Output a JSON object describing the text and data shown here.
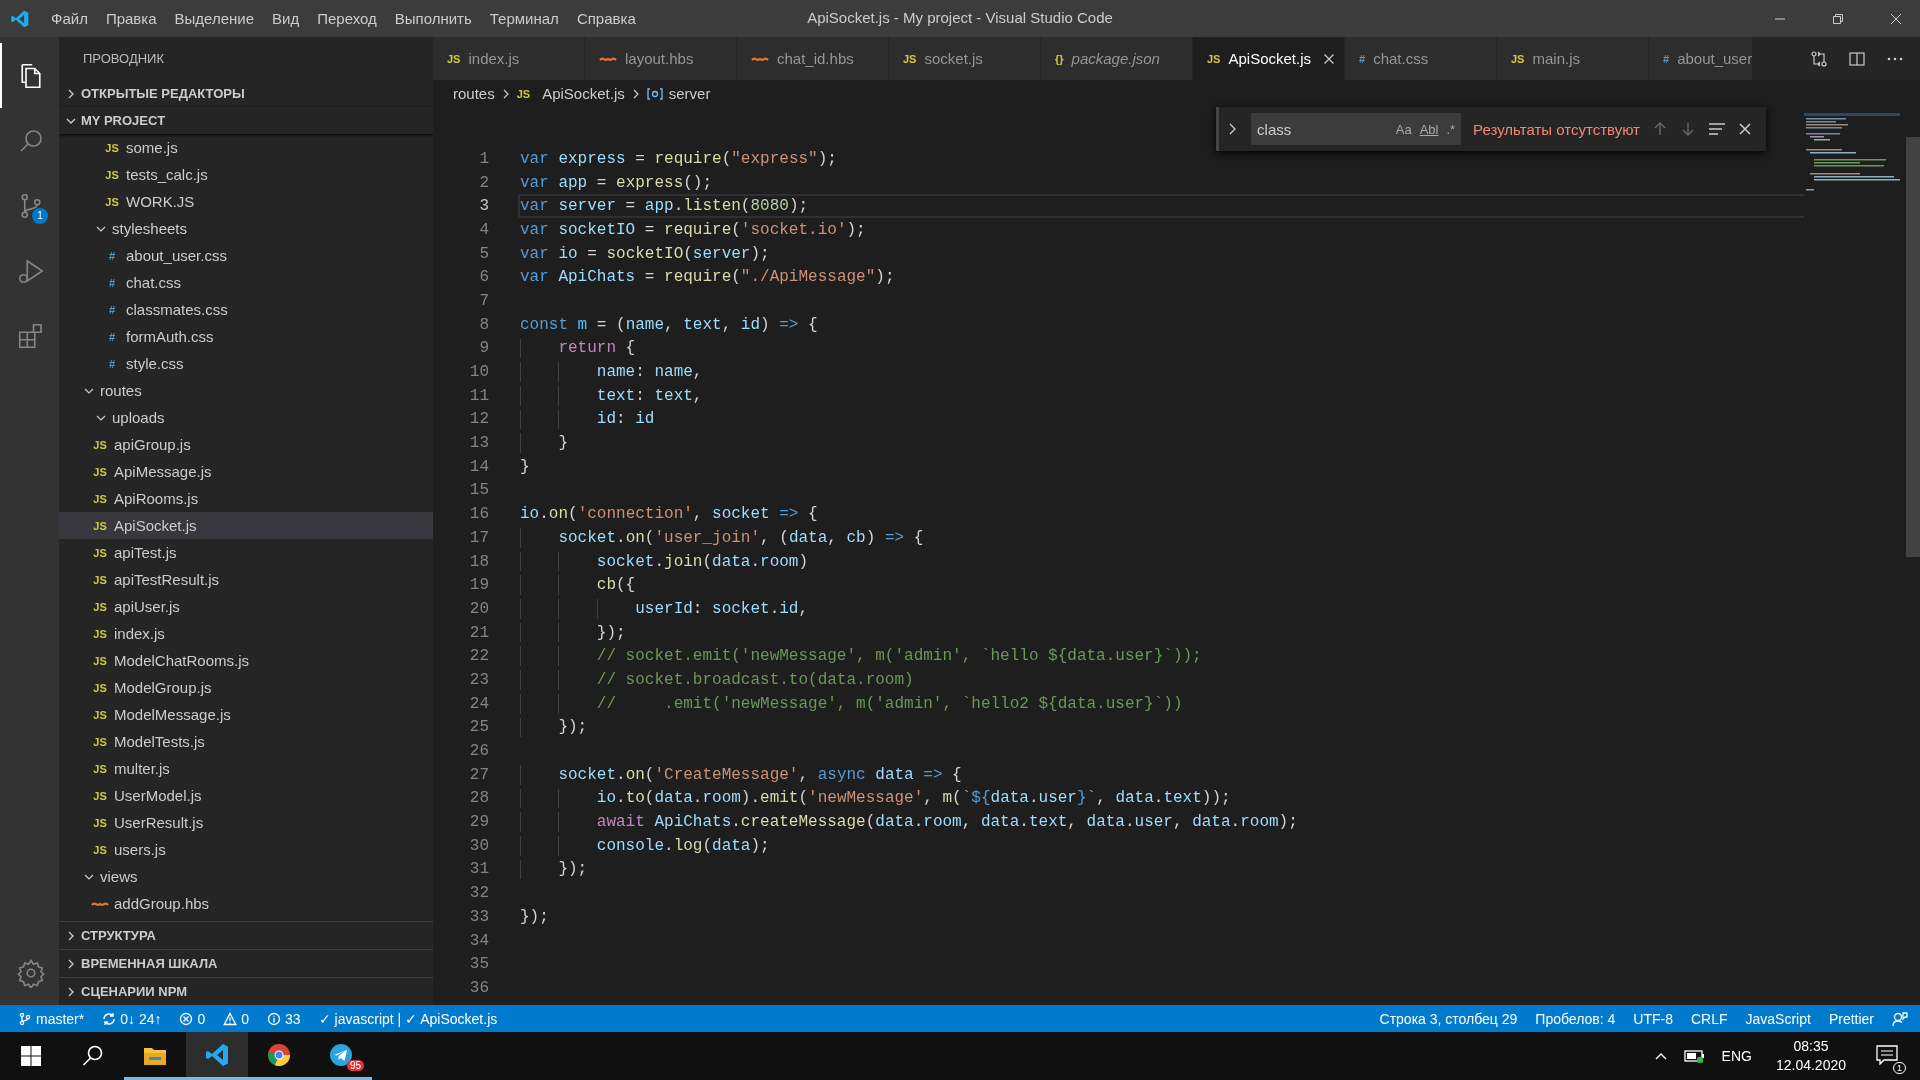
{
  "title_bar": {
    "menu": [
      "Файл",
      "Правка",
      "Выделение",
      "Вид",
      "Переход",
      "Выполнить",
      "Терминал",
      "Справка"
    ],
    "title": "ApiSocket.js - My project - Visual Studio Code"
  },
  "activity_bar": {
    "items": [
      {
        "kind": "files",
        "selected": true
      },
      {
        "kind": "search",
        "selected": false
      },
      {
        "kind": "source-control",
        "selected": false,
        "badge": "1"
      },
      {
        "kind": "run",
        "selected": false
      },
      {
        "kind": "extensions",
        "selected": false
      }
    ],
    "bottom": [
      {
        "kind": "settings"
      }
    ]
  },
  "sidebar": {
    "title": "ПРОВОДНИК",
    "sections": [
      {
        "label": "ОТКРЫТЫЕ РЕДАКТОРЫ",
        "expanded": false
      },
      {
        "label": "MY PROJECT",
        "expanded": true,
        "tree": [
          {
            "kind": "continued",
            "children": [
              {
                "kind": "continued",
                "children": [
                  {
                    "kind": "js",
                    "icon": "JS",
                    "label": "some.js",
                    "selected": false
                  },
                  {
                    "kind": "js",
                    "icon": "JS",
                    "label": "tests_calc.js",
                    "selected": false
                  },
                  {
                    "kind": "js",
                    "icon": "JS",
                    "label": "WORK.JS",
                    "selected": false
                  }
                ]
              },
              {
                "kind": "folder",
                "label": "stylesheets",
                "expanded": true,
                "selected": false,
                "children": [
                  {
                    "kind": "css",
                    "icon": "#",
                    "label": "about_user.css",
                    "selected": false
                  },
                  {
                    "kind": "css",
                    "icon": "#",
                    "label": "chat.css",
                    "selected": false
                  },
                  {
                    "kind": "css",
                    "icon": "#",
                    "label": "classmates.css",
                    "selected": false
                  },
                  {
                    "kind": "css",
                    "icon": "#",
                    "label": "formAuth.css",
                    "selected": false
                  },
                  {
                    "kind": "css",
                    "icon": "#",
                    "label": "style.css",
                    "selected": false
                  }
                ]
              }
            ]
          },
          {
            "kind": "folder",
            "label": "routes",
            "expanded": true,
            "selected": false,
            "children": [
              {
                "kind": "folder",
                "label": "uploads",
                "expanded": true,
                "selected": false
              },
              {
                "kind": "js",
                "icon": "JS",
                "label": "apiGroup.js",
                "selected": false
              },
              {
                "kind": "js",
                "icon": "JS",
                "label": "ApiMessage.js",
                "selected": false
              },
              {
                "kind": "js",
                "icon": "JS",
                "label": "ApiRooms.js",
                "selected": false
              },
              {
                "kind": "js",
                "icon": "JS",
                "label": "ApiSocket.js",
                "selected": true
              },
              {
                "kind": "js",
                "icon": "JS",
                "label": "apiTest.js",
                "selected": false
              },
              {
                "kind": "js",
                "icon": "JS",
                "label": "apiTestResult.js",
                "selected": false
              },
              {
                "kind": "js",
                "icon": "JS",
                "label": "apiUser.js",
                "selected": false
              },
              {
                "kind": "js",
                "icon": "JS",
                "label": "index.js",
                "selected": false
              },
              {
                "kind": "js",
                "icon": "JS",
                "label": "ModelChatRooms.js",
                "selected": false
              },
              {
                "kind": "js",
                "icon": "JS",
                "label": "ModelGroup.js",
                "selected": false
              },
              {
                "kind": "js",
                "icon": "JS",
                "label": "ModelMessage.js",
                "selected": false
              },
              {
                "kind": "js",
                "icon": "JS",
                "label": "ModelTests.js",
                "selected": false
              },
              {
                "kind": "js",
                "icon": "JS",
                "label": "multer.js",
                "selected": false
              },
              {
                "kind": "js",
                "icon": "JS",
                "label": "UserModel.js",
                "selected": false
              },
              {
                "kind": "js",
                "icon": "JS",
                "label": "UserResult.js",
                "selected": false
              },
              {
                "kind": "js",
                "icon": "JS",
                "label": "users.js",
                "selected": false
              }
            ]
          },
          {
            "kind": "folder",
            "label": "views",
            "expanded": true,
            "selected": false,
            "children": [
              {
                "kind": "hbs",
                "label": "addGroup.hbs",
                "selected": false
              }
            ]
          }
        ]
      }
    ],
    "bottom_sections": [
      {
        "label": "СТРУКТУРА",
        "expanded": false
      },
      {
        "label": "ВРЕМЕННАЯ ШКАЛА",
        "expanded": false
      },
      {
        "label": "СЦЕНАРИИ NPM",
        "expanded": false
      }
    ]
  },
  "tabs": [
    {
      "kind": "js",
      "icon": "JS",
      "label": "index.js",
      "selected": false,
      "preview": false
    },
    {
      "kind": "hbs",
      "label": "layout.hbs",
      "selected": false,
      "preview": false
    },
    {
      "kind": "hbs",
      "label": "chat_id.hbs",
      "selected": false,
      "preview": false
    },
    {
      "kind": "js",
      "icon": "JS",
      "label": "socket.js",
      "selected": false,
      "preview": false
    },
    {
      "kind": "json",
      "icon": "{}",
      "label": "package.json",
      "selected": false,
      "preview": true
    },
    {
      "kind": "js",
      "icon": "JS",
      "label": "ApiSocket.js",
      "selected": true,
      "preview": false
    },
    {
      "kind": "css",
      "icon": "#",
      "label": "chat.css",
      "selected": false,
      "preview": false
    },
    {
      "kind": "js",
      "icon": "JS",
      "label": "main.js",
      "selected": false,
      "preview": false
    },
    {
      "kind": "css",
      "icon": "#",
      "label": "about_user",
      "selected": false,
      "preview": false
    }
  ],
  "breadcrumbs": [
    {
      "kind": "folder",
      "label": "routes"
    },
    {
      "kind": "js",
      "icon": "JS",
      "label": "ApiSocket.js"
    },
    {
      "kind": "variable",
      "label": "server"
    }
  ],
  "find_widget": {
    "value": "class",
    "toggles": [
      {
        "label": "Aa",
        "on": false
      },
      {
        "label": "Abl",
        "on": false
      },
      {
        "label": ".*",
        "on": false
      }
    ],
    "message": "Результаты отсутствуют"
  },
  "editor": {
    "lines": [
      {
        "number": "1",
        "active": false,
        "tokens": [
          {
            "kind": "kw",
            "text": "var "
          },
          {
            "kind": "var",
            "text": "express"
          },
          {
            "kind": "p",
            "text": " = "
          },
          {
            "kind": "fn",
            "text": "require"
          },
          {
            "kind": "p",
            "text": "("
          },
          {
            "kind": "str",
            "text": "\"express\""
          },
          {
            "kind": "p",
            "text": ");"
          }
        ]
      },
      {
        "number": "2",
        "active": false,
        "tokens": [
          {
            "kind": "kw",
            "text": "var "
          },
          {
            "kind": "var",
            "text": "app"
          },
          {
            "kind": "p",
            "text": " = "
          },
          {
            "kind": "fn",
            "text": "express"
          },
          {
            "kind": "p",
            "text": "();"
          }
        ]
      },
      {
        "number": "3",
        "active": true,
        "tokens": [
          {
            "kind": "kw",
            "text": "var "
          },
          {
            "kind": "var",
            "text": "server"
          },
          {
            "kind": "p",
            "text": " = "
          },
          {
            "kind": "var",
            "text": "app"
          },
          {
            "kind": "p",
            "text": "."
          },
          {
            "kind": "fn",
            "text": "listen"
          },
          {
            "kind": "p",
            "text": "("
          },
          {
            "kind": "num",
            "text": "8080"
          },
          {
            "kind": "p",
            "text": ");"
          }
        ]
      },
      {
        "number": "4",
        "active": false,
        "tokens": [
          {
            "kind": "kw",
            "text": "var "
          },
          {
            "kind": "var",
            "text": "socketIO"
          },
          {
            "kind": "p",
            "text": " = "
          },
          {
            "kind": "fn",
            "text": "require"
          },
          {
            "kind": "p",
            "text": "("
          },
          {
            "kind": "str",
            "text": "'socket.io'"
          },
          {
            "kind": "p",
            "text": ");"
          }
        ]
      },
      {
        "number": "5",
        "active": false,
        "tokens": [
          {
            "kind": "kw",
            "text": "var "
          },
          {
            "kind": "var",
            "text": "io"
          },
          {
            "kind": "p",
            "text": " = "
          },
          {
            "kind": "fn",
            "text": "socketIO"
          },
          {
            "kind": "p",
            "text": "("
          },
          {
            "kind": "var",
            "text": "server"
          },
          {
            "kind": "p",
            "text": ");"
          }
        ]
      },
      {
        "number": "6",
        "active": false,
        "tokens": [
          {
            "kind": "kw",
            "text": "var "
          },
          {
            "kind": "var",
            "text": "ApiChats"
          },
          {
            "kind": "p",
            "text": " = "
          },
          {
            "kind": "fn",
            "text": "require"
          },
          {
            "kind": "p",
            "text": "("
          },
          {
            "kind": "str",
            "text": "\"./ApiMessage\""
          },
          {
            "kind": "p",
            "text": ");"
          }
        ]
      },
      {
        "number": "7",
        "active": false
      },
      {
        "number": "8",
        "active": false,
        "tokens": [
          {
            "kind": "kw",
            "text": "const "
          },
          {
            "kind": "const",
            "text": "m"
          },
          {
            "kind": "p",
            "text": " = ("
          },
          {
            "kind": "var",
            "text": "name"
          },
          {
            "kind": "p",
            "text": ", "
          },
          {
            "kind": "var",
            "text": "text"
          },
          {
            "kind": "p",
            "text": ", "
          },
          {
            "kind": "var",
            "text": "id"
          },
          {
            "kind": "p",
            "text": ") "
          },
          {
            "kind": "kw",
            "text": "=>"
          },
          {
            "kind": "p",
            "text": " {"
          }
        ]
      },
      {
        "number": "9",
        "active": false,
        "tokens": [
          {
            "kind": "i1"
          },
          {
            "kind": "ctl",
            "text": "return"
          },
          {
            "kind": "p",
            "text": " {"
          }
        ]
      },
      {
        "number": "10",
        "active": false,
        "tokens": [
          {
            "kind": "i2"
          },
          {
            "kind": "var",
            "text": "name"
          },
          {
            "kind": "p",
            "text": ": "
          },
          {
            "kind": "var",
            "text": "name"
          },
          {
            "kind": "p",
            "text": ","
          }
        ]
      },
      {
        "number": "11",
        "active": false,
        "tokens": [
          {
            "kind": "i2"
          },
          {
            "kind": "var",
            "text": "text"
          },
          {
            "kind": "p",
            "text": ": "
          },
          {
            "kind": "var",
            "text": "text"
          },
          {
            "kind": "p",
            "text": ","
          }
        ]
      },
      {
        "number": "12",
        "active": false,
        "tokens": [
          {
            "kind": "i2"
          },
          {
            "kind": "var",
            "text": "id"
          },
          {
            "kind": "p",
            "text": ": "
          },
          {
            "kind": "var",
            "text": "id"
          }
        ]
      },
      {
        "number": "13",
        "active": false,
        "tokens": [
          {
            "kind": "i1"
          },
          {
            "kind": "p",
            "text": "}"
          }
        ]
      },
      {
        "number": "14",
        "active": false,
        "tokens": [
          {
            "kind": "p",
            "text": "}"
          }
        ]
      },
      {
        "number": "15",
        "active": false
      },
      {
        "number": "16",
        "active": false,
        "tokens": [
          {
            "kind": "var",
            "text": "io"
          },
          {
            "kind": "p",
            "text": "."
          },
          {
            "kind": "fn",
            "text": "on"
          },
          {
            "kind": "p",
            "text": "("
          },
          {
            "kind": "str",
            "text": "'connection'"
          },
          {
            "kind": "p",
            "text": ", "
          },
          {
            "kind": "var",
            "text": "socket"
          },
          {
            "kind": "kw",
            "text": " =>"
          },
          {
            "kind": "p",
            "text": " {"
          }
        ]
      },
      {
        "number": "17",
        "active": false,
        "tokens": [
          {
            "kind": "i1"
          },
          {
            "kind": "var",
            "text": "socket"
          },
          {
            "kind": "p",
            "text": "."
          },
          {
            "kind": "fn",
            "text": "on"
          },
          {
            "kind": "p",
            "text": "("
          },
          {
            "kind": "str",
            "text": "'user_join'"
          },
          {
            "kind": "p",
            "text": ", ("
          },
          {
            "kind": "var",
            "text": "data"
          },
          {
            "kind": "p",
            "text": ", "
          },
          {
            "kind": "var",
            "text": "cb"
          },
          {
            "kind": "p",
            "text": ") "
          },
          {
            "kind": "kw",
            "text": "=>"
          },
          {
            "kind": "p",
            "text": " {"
          }
        ]
      },
      {
        "number": "18",
        "active": false,
        "tokens": [
          {
            "kind": "i2"
          },
          {
            "kind": "var",
            "text": "socket"
          },
          {
            "kind": "p",
            "text": "."
          },
          {
            "kind": "fn",
            "text": "join"
          },
          {
            "kind": "p",
            "text": "("
          },
          {
            "kind": "var",
            "text": "data"
          },
          {
            "kind": "p",
            "text": "."
          },
          {
            "kind": "var",
            "text": "room"
          },
          {
            "kind": "p",
            "text": ")"
          }
        ]
      },
      {
        "number": "19",
        "active": false,
        "tokens": [
          {
            "kind": "i2"
          },
          {
            "kind": "fn",
            "text": "cb"
          },
          {
            "kind": "p",
            "text": "({"
          }
        ]
      },
      {
        "number": "20",
        "active": false,
        "tokens": [
          {
            "kind": "i3"
          },
          {
            "kind": "var",
            "text": "userId"
          },
          {
            "kind": "p",
            "text": ": "
          },
          {
            "kind": "var",
            "text": "socket"
          },
          {
            "kind": "p",
            "text": "."
          },
          {
            "kind": "var",
            "text": "id"
          },
          {
            "kind": "p",
            "text": ","
          }
        ]
      },
      {
        "number": "21",
        "active": false,
        "tokens": [
          {
            "kind": "i2"
          },
          {
            "kind": "p",
            "text": "});"
          }
        ]
      },
      {
        "number": "22",
        "active": false,
        "tokens": [
          {
            "kind": "i2"
          },
          {
            "kind": "cmt",
            "text": "// socket.emit('newMessage', m('admin', `hello ${data.user}`));"
          }
        ]
      },
      {
        "number": "23",
        "active": false,
        "tokens": [
          {
            "kind": "i2"
          },
          {
            "kind": "cmt",
            "text": "// socket.broadcast.to(data.room)"
          }
        ]
      },
      {
        "number": "24",
        "active": false,
        "tokens": [
          {
            "kind": "i2"
          },
          {
            "kind": "cmt",
            "text": "//     .emit('newMessage', m('admin', `hello2 ${data.user}`))"
          }
        ]
      },
      {
        "number": "25",
        "active": false,
        "tokens": [
          {
            "kind": "i1"
          },
          {
            "kind": "p",
            "text": "});"
          }
        ]
      },
      {
        "number": "26",
        "active": false
      },
      {
        "number": "27",
        "active": false,
        "tokens": [
          {
            "kind": "i1"
          },
          {
            "kind": "var",
            "text": "socket"
          },
          {
            "kind": "p",
            "text": "."
          },
          {
            "kind": "fn",
            "text": "on"
          },
          {
            "kind": "p",
            "text": "("
          },
          {
            "kind": "str",
            "text": "'CreateMessage'"
          },
          {
            "kind": "p",
            "text": ", "
          },
          {
            "kind": "kw",
            "text": "async "
          },
          {
            "kind": "var",
            "text": "data"
          },
          {
            "kind": "kw",
            "text": " =>"
          },
          {
            "kind": "p",
            "text": " {"
          }
        ]
      },
      {
        "number": "28",
        "active": false,
        "tokens": [
          {
            "kind": "i2"
          },
          {
            "kind": "var",
            "text": "io"
          },
          {
            "kind": "p",
            "text": "."
          },
          {
            "kind": "fn",
            "text": "to"
          },
          {
            "kind": "p",
            "text": "("
          },
          {
            "kind": "var",
            "text": "data"
          },
          {
            "kind": "p",
            "text": "."
          },
          {
            "kind": "var",
            "text": "room"
          },
          {
            "kind": "p",
            "text": ")."
          },
          {
            "kind": "fn",
            "text": "emit"
          },
          {
            "kind": "p",
            "text": "("
          },
          {
            "kind": "str",
            "text": "'newMessage'"
          },
          {
            "kind": "p",
            "text": ", "
          },
          {
            "kind": "fn",
            "text": "m"
          },
          {
            "kind": "p",
            "text": "("
          },
          {
            "kind": "str",
            "text": "`"
          },
          {
            "kind": "kw",
            "text": "${"
          },
          {
            "kind": "var",
            "text": "data"
          },
          {
            "kind": "p",
            "text": "."
          },
          {
            "kind": "var",
            "text": "user"
          },
          {
            "kind": "kw",
            "text": "}"
          },
          {
            "kind": "str",
            "text": "`"
          },
          {
            "kind": "p",
            "text": ", "
          },
          {
            "kind": "var",
            "text": "data"
          },
          {
            "kind": "p",
            "text": "."
          },
          {
            "kind": "var",
            "text": "text"
          },
          {
            "kind": "p",
            "text": "));"
          }
        ]
      },
      {
        "number": "29",
        "active": false,
        "tokens": [
          {
            "kind": "i2"
          },
          {
            "kind": "ctl",
            "text": "await "
          },
          {
            "kind": "var",
            "text": "ApiChats"
          },
          {
            "kind": "p",
            "text": "."
          },
          {
            "kind": "fn",
            "text": "createMessage"
          },
          {
            "kind": "p",
            "text": "("
          },
          {
            "kind": "var",
            "text": "data"
          },
          {
            "kind": "p",
            "text": "."
          },
          {
            "kind": "var",
            "text": "room"
          },
          {
            "kind": "p",
            "text": ", "
          },
          {
            "kind": "var",
            "text": "data"
          },
          {
            "kind": "p",
            "text": "."
          },
          {
            "kind": "var",
            "text": "text"
          },
          {
            "kind": "p",
            "text": ", "
          },
          {
            "kind": "var",
            "text": "data"
          },
          {
            "kind": "p",
            "text": "."
          },
          {
            "kind": "var",
            "text": "user"
          },
          {
            "kind": "p",
            "text": ", "
          },
          {
            "kind": "var",
            "text": "data"
          },
          {
            "kind": "p",
            "text": "."
          },
          {
            "kind": "var",
            "text": "room"
          },
          {
            "kind": "p",
            "text": ");"
          }
        ]
      },
      {
        "number": "30",
        "active": false,
        "tokens": [
          {
            "kind": "i2"
          },
          {
            "kind": "var",
            "text": "console"
          },
          {
            "kind": "p",
            "text": "."
          },
          {
            "kind": "fn",
            "text": "log"
          },
          {
            "kind": "p",
            "text": "("
          },
          {
            "kind": "var",
            "text": "data"
          },
          {
            "kind": "p",
            "text": ");"
          }
        ]
      },
      {
        "number": "31",
        "active": false,
        "tokens": [
          {
            "kind": "i1"
          },
          {
            "kind": "p",
            "text": "});"
          }
        ]
      },
      {
        "number": "32",
        "active": false
      },
      {
        "number": "33",
        "active": false,
        "tokens": [
          {
            "kind": "p",
            "text": "});"
          }
        ]
      },
      {
        "number": "34",
        "active": false
      },
      {
        "number": "35",
        "active": false
      },
      {
        "number": "36",
        "active": false
      }
    ]
  },
  "status_bar": {
    "left": [
      {
        "kind": "branch",
        "text": "master*"
      },
      {
        "kind": "sync",
        "text": "0↓ 24↑"
      },
      {
        "kind": "error",
        "text": "0"
      },
      {
        "kind": "warning",
        "text": "0"
      },
      {
        "kind": "info",
        "text": "33"
      },
      {
        "kind": "plain",
        "text": "✓ javascript | ✓ ApiSocket.js"
      }
    ],
    "right": [
      {
        "kind": "plain",
        "text": "Строка 3, столбец 29"
      },
      {
        "kind": "plain",
        "text": "Пробелов: 4"
      },
      {
        "kind": "plain",
        "text": "UTF-8"
      },
      {
        "kind": "plain",
        "text": "CRLF"
      },
      {
        "kind": "plain",
        "text": "JavaScript"
      },
      {
        "kind": "plain",
        "text": "Prettier"
      },
      {
        "kind": "feedback"
      }
    ]
  },
  "taskbar": {
    "apps": [
      {
        "kind": "start",
        "selected": false
      },
      {
        "kind": "search",
        "selected": false
      },
      {
        "kind": "folder",
        "selected": false,
        "running": true
      },
      {
        "kind": "vscode",
        "selected": true,
        "running": true
      },
      {
        "kind": "chrome",
        "selected": false,
        "running": true
      },
      {
        "kind": "telegram",
        "selected": false,
        "running": true,
        "badge": "95"
      }
    ],
    "tray": {
      "language": "ENG",
      "time": "08:35",
      "date": "12.04.2020",
      "notifications": "1"
    }
  }
}
